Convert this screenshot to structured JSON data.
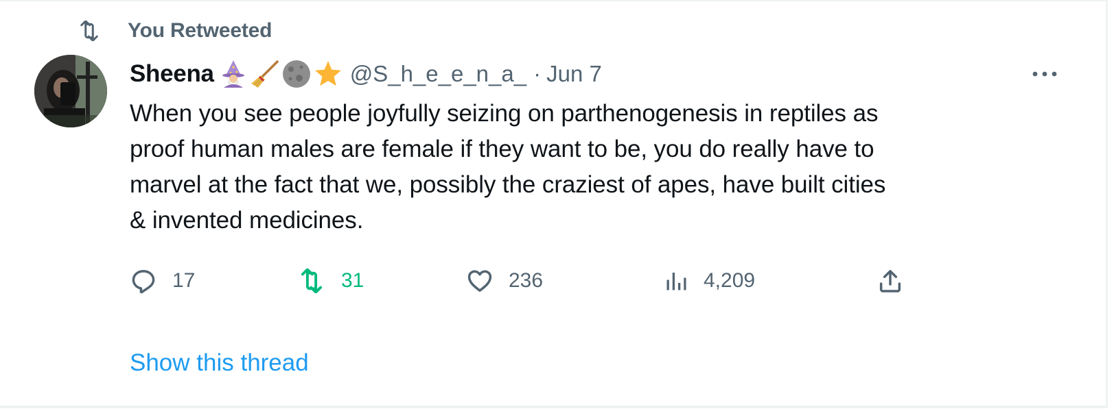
{
  "retweet_context": {
    "icon": "retweet-icon",
    "label": "You Retweeted"
  },
  "tweet": {
    "author": {
      "display_name": "Sheena",
      "emojis": [
        "wizard-emoji",
        "broom-emoji",
        "moon-emoji",
        "star-emoji"
      ],
      "handle": "@S_h_e_e_n_a_",
      "separator": "·",
      "time": "Jun 7"
    },
    "text": "When you see people joyfully seizing on parthenogenesis in reptiles as\nproof human males are female if they want to be, you do really have to\nmarvel at the fact that we, possibly the craziest of apes, have built cities\n& invented medicines.",
    "actions": {
      "reply": {
        "icon": "reply-icon",
        "count": "17"
      },
      "retweet": {
        "icon": "retweet-icon",
        "count": "31",
        "active_color": "#00ba7c"
      },
      "like": {
        "icon": "heart-icon",
        "count": "236"
      },
      "views": {
        "icon": "analytics-icon",
        "count": "4,209"
      },
      "share": {
        "icon": "share-icon"
      }
    },
    "show_thread": "Show this thread"
  },
  "colors": {
    "text_primary": "#0f1419",
    "text_secondary": "#536471",
    "link": "#1d9bf0",
    "retweet_active": "#00ba7c"
  }
}
